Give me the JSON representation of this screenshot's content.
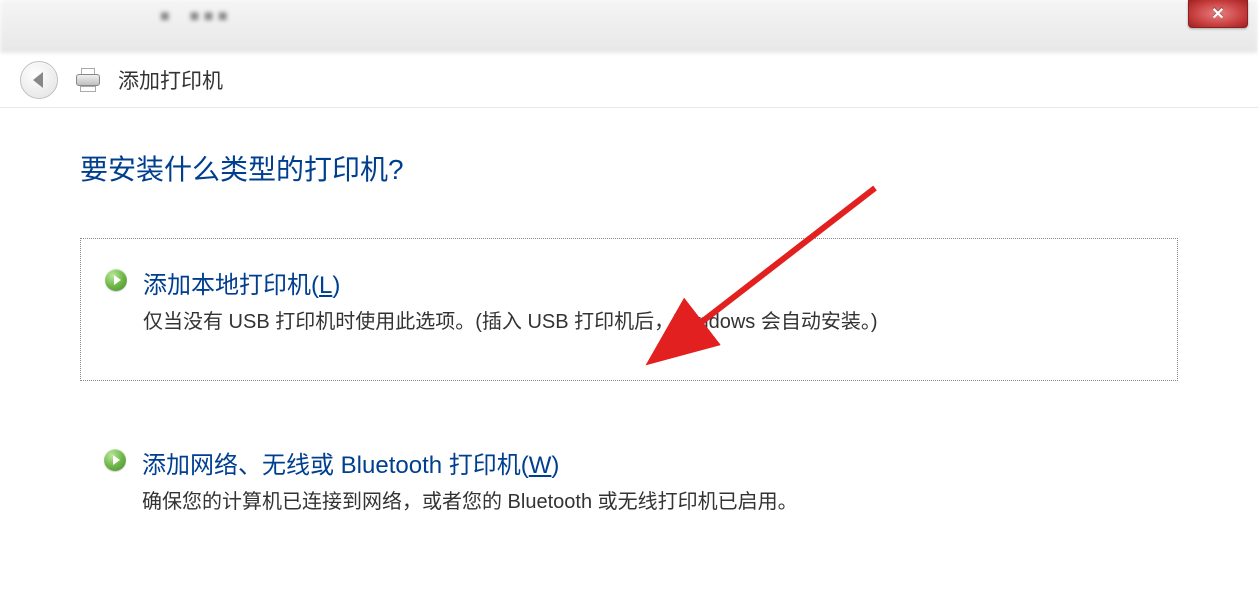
{
  "window": {
    "close_label": "✕"
  },
  "header": {
    "title": "添加打印机"
  },
  "content": {
    "heading": "要安装什么类型的打印机?",
    "options": [
      {
        "title_prefix": "添加本地打印机(",
        "shortcut": "L",
        "title_suffix": ")",
        "description": "仅当没有 USB 打印机时使用此选项。(插入 USB 打印机后，Windows 会自动安装。)"
      },
      {
        "title_prefix": "添加网络、无线或 Bluetooth 打印机(",
        "shortcut": "W",
        "title_suffix": ")",
        "description": "确保您的计算机已连接到网络，或者您的 Bluetooth 或无线打印机已启用。"
      }
    ]
  }
}
